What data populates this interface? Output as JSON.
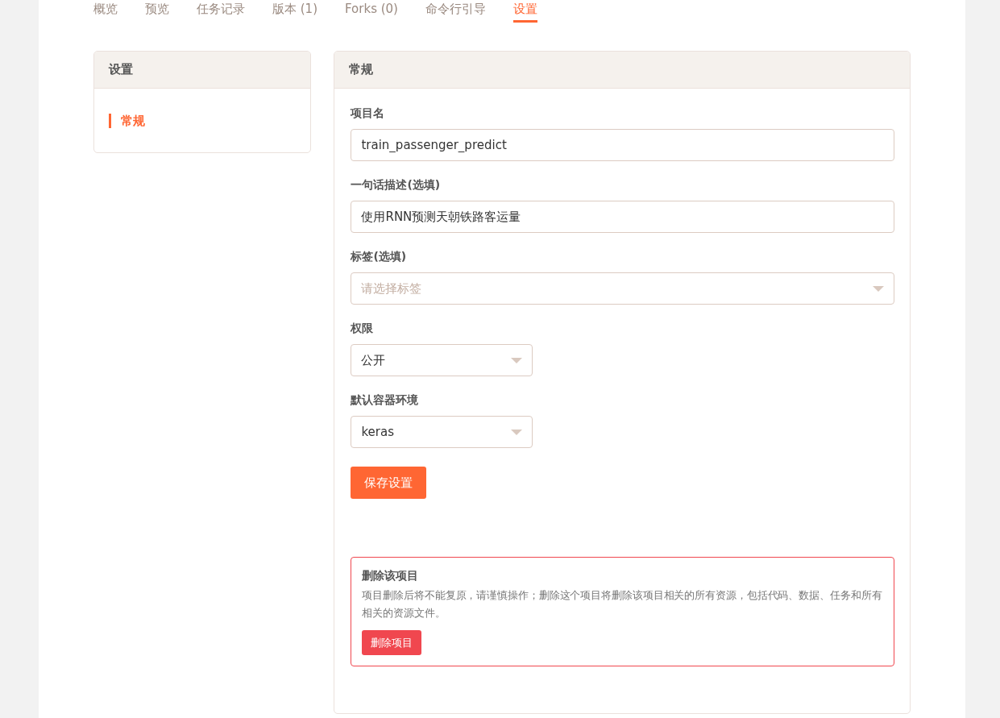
{
  "tabs": [
    {
      "label": "概览",
      "selected": false
    },
    {
      "label": "预览",
      "selected": false
    },
    {
      "label": "任务记录",
      "selected": false
    },
    {
      "label": "版本 (1)",
      "selected": false
    },
    {
      "label": "Forks (0)",
      "selected": false
    },
    {
      "label": "命令行引导",
      "selected": false
    },
    {
      "label": "设置",
      "selected": true
    }
  ],
  "sidebar": {
    "title": "设置",
    "items": [
      {
        "label": "常规",
        "selected": true
      }
    ]
  },
  "panel": {
    "title": "常规",
    "fields": [
      {
        "kind": "text",
        "label": "项目名",
        "value": "train_passenger_predict"
      },
      {
        "kind": "text",
        "label": "一句话描述(选填)",
        "value": "使用RNN预测天朝铁路客运量"
      },
      {
        "kind": "multiselect",
        "label": "标签(选填)",
        "placeholder": "请选择标签"
      },
      {
        "kind": "select",
        "label": "权限",
        "value": "公开"
      },
      {
        "kind": "select",
        "label": "默认容器环境",
        "value": "keras"
      }
    ],
    "save_button": "保存设置",
    "danger_zone": {
      "title": "删除该项目",
      "text": "项目删除后将不能复原，请谨慎操作；删除这个项目将删除该项目相关的所有资源，包括代码、数据、任务和所有相关的资源文件。",
      "button": "删除项目"
    }
  }
}
